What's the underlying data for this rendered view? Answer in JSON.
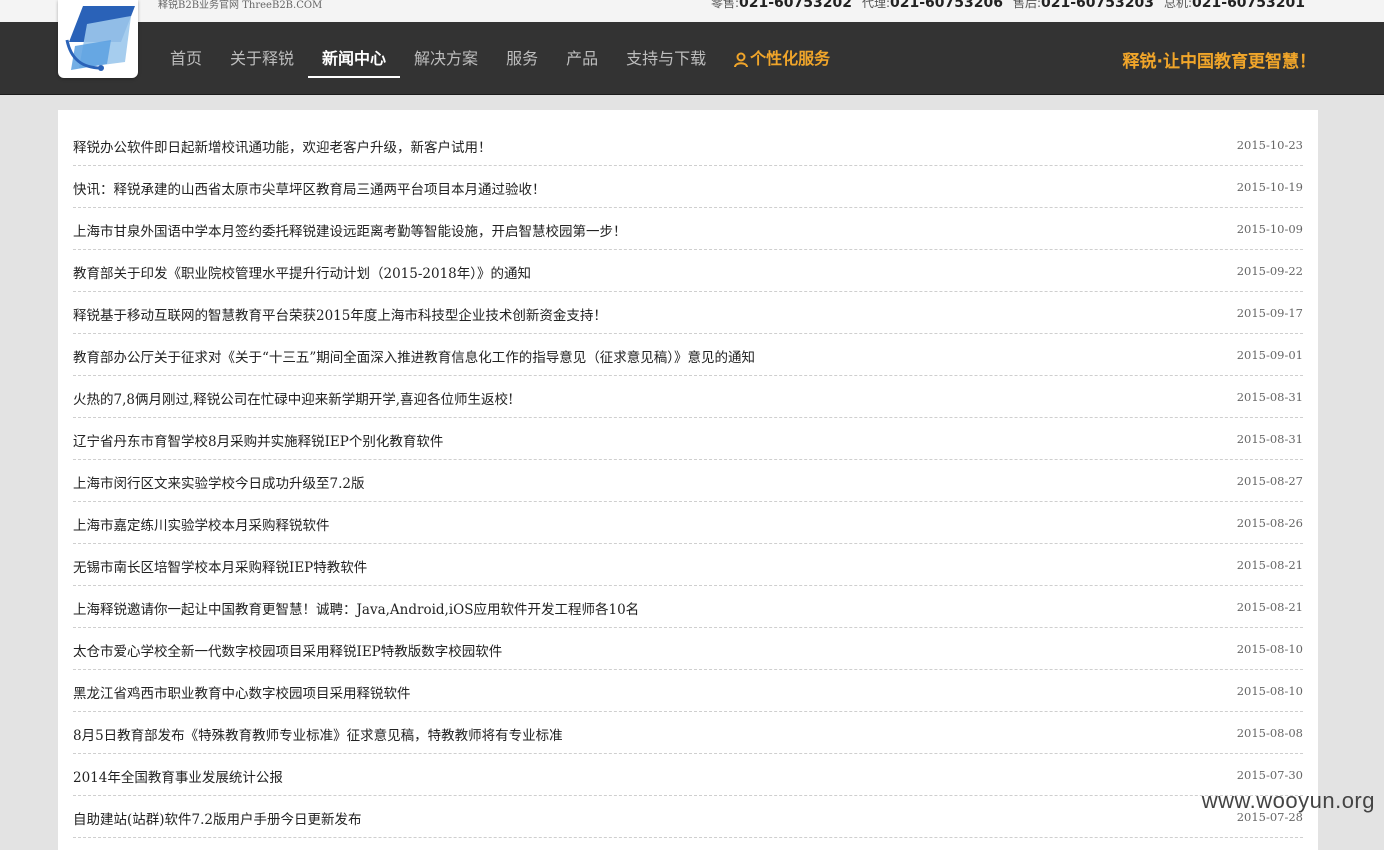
{
  "header": {
    "site_label": "释锐B2B业务官网 ThreeB2B.COM",
    "phones": [
      {
        "label": "零售:",
        "number": "021-60753202"
      },
      {
        "label": "代理:",
        "number": "021-60753206"
      },
      {
        "label": "售后:",
        "number": "021-60753203"
      },
      {
        "label": "总机:",
        "number": "021-60753201"
      }
    ]
  },
  "nav": {
    "items": [
      {
        "label": "首页"
      },
      {
        "label": "关于释锐"
      },
      {
        "label": "新闻中心"
      },
      {
        "label": "解决方案"
      },
      {
        "label": "服务"
      },
      {
        "label": "产品"
      },
      {
        "label": "支持与下载"
      },
      {
        "label": "个性化服务"
      }
    ],
    "active_index": 2,
    "special_icon": "user-icon",
    "slogan": "释锐·让中国教育更智慧！"
  },
  "colors": {
    "nav_bg": "#333333",
    "accent": "#f0a52a",
    "logo_blue": "#2a62b8",
    "logo_light": "#9cc8ec"
  },
  "news": [
    {
      "title": "释锐办公软件即日起新增校讯通功能，欢迎老客户升级，新客户试用！",
      "date": "2015-10-23"
    },
    {
      "title": "快讯：释锐承建的山西省太原市尖草坪区教育局三通两平台项目本月通过验收！",
      "date": "2015-10-19"
    },
    {
      "title": "上海市甘泉外国语中学本月签约委托释锐建设远距离考勤等智能设施，开启智慧校园第一步！",
      "date": "2015-10-09"
    },
    {
      "title": "教育部关于印发《职业院校管理水平提升行动计划（2015-2018年）》的通知",
      "date": "2015-09-22"
    },
    {
      "title": "释锐基于移动互联网的智慧教育平台荣获2015年度上海市科技型企业技术创新资金支持！",
      "date": "2015-09-17"
    },
    {
      "title": "教育部办公厅关于征求对《关于“十三五”期间全面深入推进教育信息化工作的指导意见（征求意见稿）》意见的通知",
      "date": "2015-09-01"
    },
    {
      "title": "火热的7,8俩月刚过,释锐公司在忙碌中迎来新学期开学,喜迎各位师生返校!",
      "date": "2015-08-31"
    },
    {
      "title": "辽宁省丹东市育智学校8月采购并实施释锐IEP个别化教育软件",
      "date": "2015-08-31"
    },
    {
      "title": "上海市闵行区文来实验学校今日成功升级至7.2版",
      "date": "2015-08-27"
    },
    {
      "title": "上海市嘉定练川实验学校本月采购释锐软件",
      "date": "2015-08-26"
    },
    {
      "title": "无锡市南长区培智学校本月采购释锐IEP特教软件",
      "date": "2015-08-21"
    },
    {
      "title": "上海释锐邀请你一起让中国教育更智慧！诚聘：Java,Android,iOS应用软件开发工程师各10名",
      "date": "2015-08-21"
    },
    {
      "title": "太仓市爱心学校全新一代数字校园项目采用释锐IEP特教版数字校园软件",
      "date": "2015-08-10"
    },
    {
      "title": "黑龙江省鸡西市职业教育中心数字校园项目采用释锐软件",
      "date": "2015-08-10"
    },
    {
      "title": "8月5日教育部发布《特殊教育教师专业标准》征求意见稿，特教教师将有专业标准",
      "date": "2015-08-08"
    },
    {
      "title": "2014年全国教育事业发展统计公报",
      "date": "2015-07-30"
    },
    {
      "title": "自助建站(站群)软件7.2版用户手册今日更新发布",
      "date": "2015-07-28"
    }
  ],
  "watermark": "www.wooyun.org"
}
